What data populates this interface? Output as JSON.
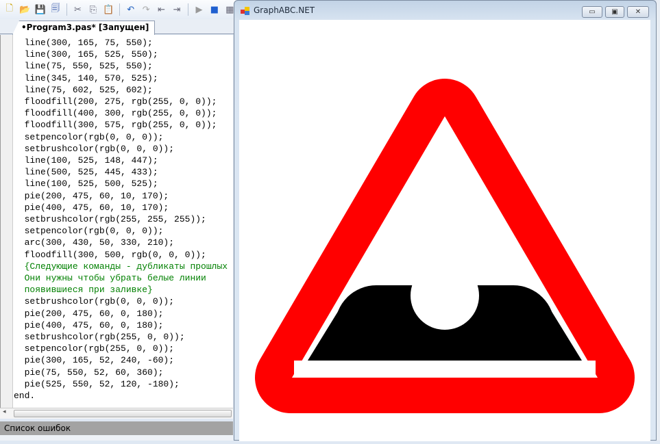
{
  "toolbar": {
    "icons": [
      "new-file-icon",
      "open-folder-icon",
      "save-icon",
      "save-all-icon",
      "cut-icon",
      "copy-icon",
      "paste-icon",
      "undo-icon",
      "redo-icon",
      "outdent-icon",
      "indent-icon",
      "run-icon",
      "stop-icon",
      "breakpoint-icon"
    ]
  },
  "editor": {
    "tab_label": "•Program3.pas* [Запущен]",
    "lines": [
      "  line(300, 165, 75, 550);",
      "  line(300, 165, 525, 550);",
      "  line(75, 550, 525, 550);",
      "  line(345, 140, 570, 525);",
      "  line(75, 602, 525, 602);",
      "  floodfill(200, 275, rgb(255, 0, 0));",
      "  floodfill(400, 300, rgb(255, 0, 0));",
      "  floodfill(300, 575, rgb(255, 0, 0));",
      "  setpencolor(rgb(0, 0, 0));",
      "  setbrushcolor(rgb(0, 0, 0));",
      "  line(100, 525, 148, 447);",
      "  line(500, 525, 445, 433);",
      "  line(100, 525, 500, 525);",
      "  pie(200, 475, 60, 10, 170);",
      "  pie(400, 475, 60, 10, 170);",
      "  setbrushcolor(rgb(255, 255, 255));",
      "  setpencolor(rgb(0, 0, 0));",
      "  arc(300, 430, 50, 330, 210);",
      "  floodfill(300, 500, rgb(0, 0, 0));",
      "  {Следующие команды - дубликаты прошлых",
      "  Они нужны чтобы убрать белые линии",
      "  появившиеся при заливке}",
      "  setbrushcolor(rgb(0, 0, 0));",
      "  pie(200, 475, 60, 0, 180);",
      "  pie(400, 475, 60, 0, 180);",
      "  setbrushcolor(rgb(255, 0, 0));",
      "  setpencolor(rgb(255, 0, 0));",
      "  pie(300, 165, 52, 240, -60);",
      "  pie(75, 550, 52, 60, 360);",
      "  pie(525, 550, 52, 120, -180);",
      "end."
    ],
    "comment_lines": [
      19,
      20,
      21
    ]
  },
  "error_panel": {
    "title": "Список ошибок"
  },
  "graph_window": {
    "title": "GraphABC.NET",
    "minimize": "▭",
    "maximize": "▣",
    "close": "✕",
    "colors": {
      "red": "#ff0000",
      "black": "#000000",
      "white": "#ffffff"
    }
  }
}
